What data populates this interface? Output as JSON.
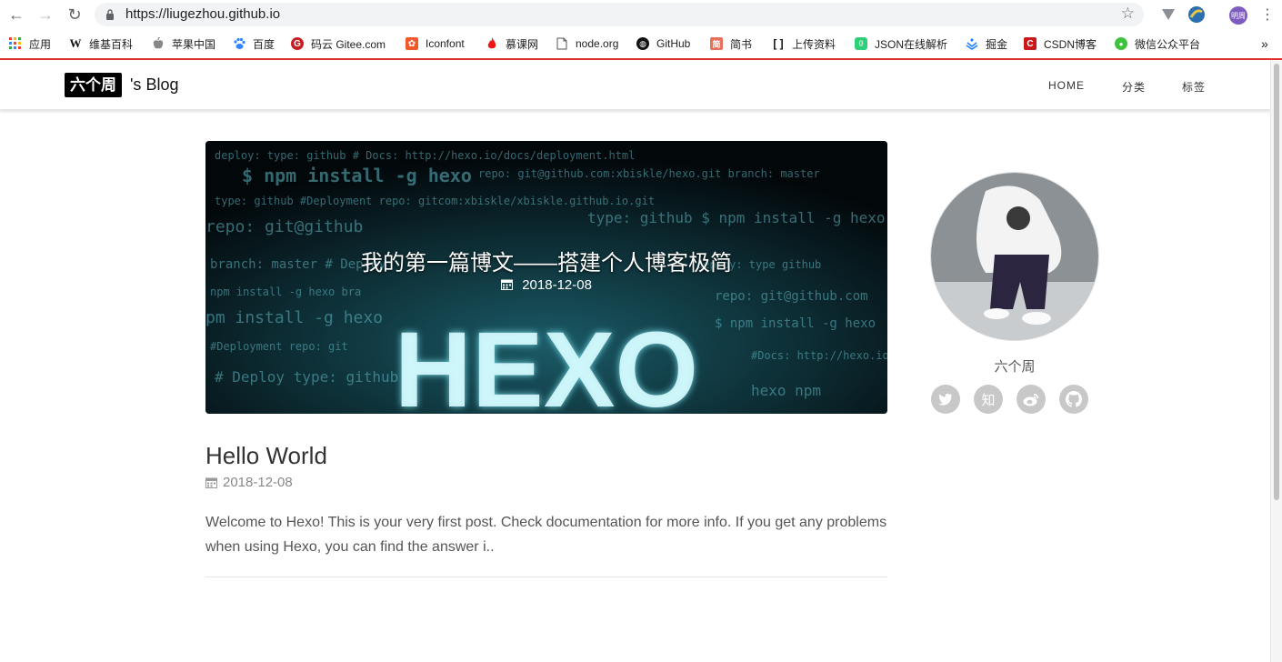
{
  "browser": {
    "url": "https://liugezhou.github.io",
    "profile_initials": "明周",
    "bookmarks": [
      {
        "label": "应用",
        "icon": "apps-grid-icon"
      },
      {
        "label": "维基百科",
        "icon": "wikipedia-icon"
      },
      {
        "label": "苹果中国",
        "icon": "apple-icon"
      },
      {
        "label": "百度",
        "icon": "baidu-paw-icon"
      },
      {
        "label": "码云 Gitee.com",
        "icon": "gitee-icon"
      },
      {
        "label": "Iconfont",
        "icon": "iconfont-icon"
      },
      {
        "label": "慕课网",
        "icon": "flame-icon"
      },
      {
        "label": "node.org",
        "icon": "file-icon"
      },
      {
        "label": "GitHub",
        "icon": "github-icon"
      },
      {
        "label": "简书",
        "icon": "jianshu-icon"
      },
      {
        "label": "上传资料",
        "icon": "code-bracket-icon"
      },
      {
        "label": "JSON在线解析",
        "icon": "json-icon"
      },
      {
        "label": "掘金",
        "icon": "juejin-icon"
      },
      {
        "label": "CSDN博客",
        "icon": "csdn-icon"
      },
      {
        "label": "微信公众平台",
        "icon": "wechat-icon"
      }
    ],
    "overflow_label": "»"
  },
  "blog": {
    "logo_text": "六个周",
    "logo_suffix": "'s Blog",
    "menu": [
      "HOME",
      "分类",
      "标签"
    ]
  },
  "hero": {
    "title": "我的第一篇博文——搭建个人博客极简",
    "date": "2018-12-08",
    "image_word": "HEXO"
  },
  "post": {
    "title": "Hello World",
    "date": "2018-12-08",
    "excerpt": "Welcome to Hexo! This is your very first post. Check documentation for more info. If you get any problems when using Hexo, you can find the answer i.."
  },
  "sidebar": {
    "author": "六个周",
    "social": [
      {
        "icon": "twitter-icon",
        "glyph": "🐦"
      },
      {
        "icon": "zhihu-icon",
        "glyph": "知"
      },
      {
        "icon": "weibo-icon",
        "glyph": "◉"
      },
      {
        "icon": "github-icon",
        "glyph": "◍"
      }
    ]
  },
  "colors": {
    "accent_line": "#e0312b",
    "hero_glow": "#7fe8f5",
    "social_bg": "#c8c8c8"
  }
}
